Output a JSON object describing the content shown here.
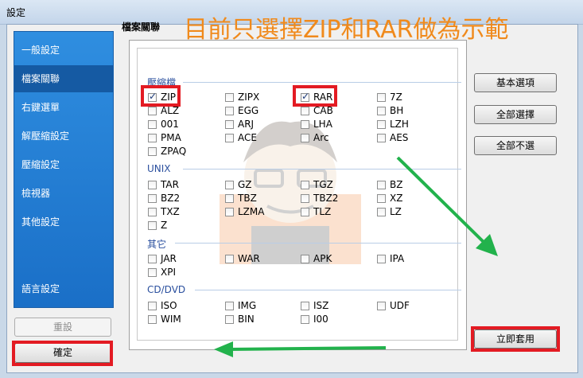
{
  "window": {
    "title": "設定"
  },
  "annotation": {
    "headline": "目前只選擇ZIP和RAR做為示範"
  },
  "sidebar": {
    "items": [
      {
        "label": "一般設定",
        "active": false
      },
      {
        "label": "檔案關聯",
        "active": true
      },
      {
        "label": "右鍵選單",
        "active": false
      },
      {
        "label": "解壓縮設定",
        "active": false
      },
      {
        "label": "壓縮設定",
        "active": false
      },
      {
        "label": "檢視器",
        "active": false
      },
      {
        "label": "其他設定",
        "active": false
      },
      {
        "label": "語言設定",
        "active": false
      }
    ],
    "reset_label": "重設",
    "ok_label": "確定"
  },
  "panel": {
    "title": "檔案關聯"
  },
  "sections": {
    "archives": {
      "label": "壓縮檔",
      "items": [
        {
          "label": "ZIP",
          "checked": true
        },
        {
          "label": "ZIPX",
          "checked": false
        },
        {
          "label": "RAR",
          "checked": true
        },
        {
          "label": "7Z",
          "checked": false
        },
        {
          "label": "ALZ",
          "checked": false
        },
        {
          "label": "EGG",
          "checked": false
        },
        {
          "label": "CAB",
          "checked": false
        },
        {
          "label": "BH",
          "checked": false
        },
        {
          "label": "001",
          "checked": false
        },
        {
          "label": "ARJ",
          "checked": false
        },
        {
          "label": "LHA",
          "checked": false
        },
        {
          "label": "LZH",
          "checked": false
        },
        {
          "label": "PMA",
          "checked": false
        },
        {
          "label": "ACE",
          "checked": false
        },
        {
          "label": "Arc",
          "checked": false
        },
        {
          "label": "AES",
          "checked": false
        },
        {
          "label": "ZPAQ",
          "checked": false
        }
      ]
    },
    "unix": {
      "label": "UNIX",
      "items": [
        {
          "label": "TAR",
          "checked": false
        },
        {
          "label": "GZ",
          "checked": false
        },
        {
          "label": "TGZ",
          "checked": false
        },
        {
          "label": "BZ",
          "checked": false
        },
        {
          "label": "BZ2",
          "checked": false
        },
        {
          "label": "TBZ",
          "checked": false
        },
        {
          "label": "TBZ2",
          "checked": false
        },
        {
          "label": "XZ",
          "checked": false
        },
        {
          "label": "TXZ",
          "checked": false
        },
        {
          "label": "LZMA",
          "checked": false
        },
        {
          "label": "TLZ",
          "checked": false
        },
        {
          "label": "LZ",
          "checked": false
        },
        {
          "label": "Z",
          "checked": false
        }
      ]
    },
    "others": {
      "label": "其它",
      "items": [
        {
          "label": "JAR",
          "checked": false
        },
        {
          "label": "WAR",
          "checked": false
        },
        {
          "label": "APK",
          "checked": false
        },
        {
          "label": "IPA",
          "checked": false
        },
        {
          "label": "XPI",
          "checked": false
        }
      ]
    },
    "cddvd": {
      "label": "CD/DVD",
      "items": [
        {
          "label": "ISO",
          "checked": false
        },
        {
          "label": "IMG",
          "checked": false
        },
        {
          "label": "ISZ",
          "checked": false
        },
        {
          "label": "UDF",
          "checked": false
        },
        {
          "label": "WIM",
          "checked": false
        },
        {
          "label": "BIN",
          "checked": false
        },
        {
          "label": "I00",
          "checked": false
        }
      ]
    }
  },
  "actions": {
    "basic_label": "基本選項",
    "select_all_label": "全部選擇",
    "deselect_all_label": "全部不選",
    "apply_label": "立即套用"
  },
  "colors": {
    "highlight": "#e31b23",
    "annotation_text": "#f08a1c",
    "arrow": "#22b24c",
    "sidebar": "#1f78d1"
  }
}
